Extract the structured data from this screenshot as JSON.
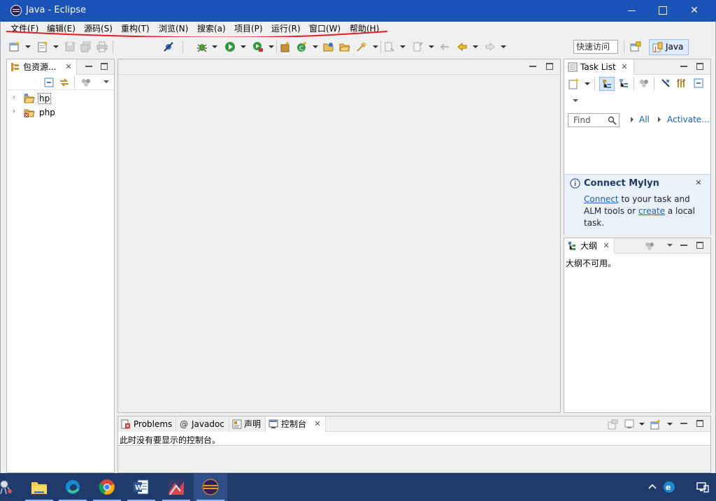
{
  "window": {
    "title": "Java  -  Eclipse",
    "minimize_label": "",
    "maximize_label": "",
    "close_label": "✕"
  },
  "menu": [
    "文件(F)",
    "编辑(E)",
    "源码(S)",
    "重构(T)",
    "浏览(N)",
    "搜索(a)",
    "项目(P)",
    "运行(R)",
    "窗口(W)",
    "帮助(H)"
  ],
  "annotation_color": "#e02020",
  "toolbar": {
    "quick_access": "快速访问",
    "perspective": "Java"
  },
  "package_explorer": {
    "tab_label": "包资源...",
    "projects": [
      {
        "name": "hp",
        "icon": "project-folder-icon"
      },
      {
        "name": "php",
        "icon": "project-folder-error-icon"
      }
    ]
  },
  "task_list": {
    "tab_label": "Task List",
    "find_placeholder": "Find",
    "filter_all": "All",
    "filter_activate": "Activate...",
    "mylyn": {
      "title": "Connect Mylyn",
      "link_connect": "Connect",
      "text_1": " to your task and ALM tools or ",
      "link_create": "create",
      "text_2": " a local task."
    }
  },
  "outline": {
    "tab_label": "大纲",
    "message": "大纲不可用。"
  },
  "bottom": {
    "tabs": [
      {
        "label": "Problems",
        "icon": "problems-icon"
      },
      {
        "label": "Javadoc",
        "icon": "at-sign-icon"
      },
      {
        "label": "声明",
        "icon": "declaration-icon"
      },
      {
        "label": "控制台",
        "icon": "console-icon"
      }
    ],
    "console_message": "此时没有要显示的控制台。"
  },
  "taskbar": {
    "apps": [
      "file-explorer-icon",
      "edge-icon",
      "chrome-icon",
      "word-icon",
      "image-app-icon",
      "eclipse-icon"
    ],
    "tray": [
      "chevron-up-icon",
      "edge-tray-icon",
      "network-icon"
    ]
  }
}
